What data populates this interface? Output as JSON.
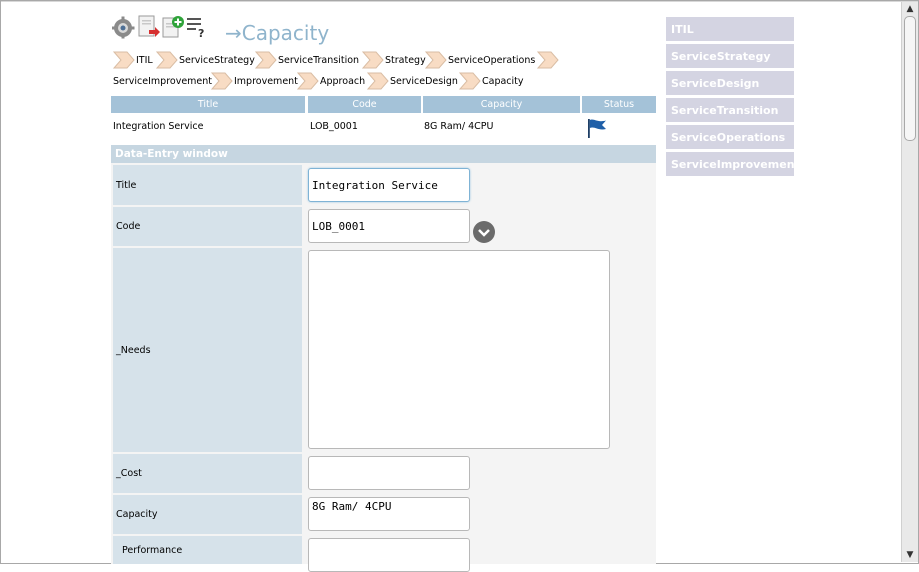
{
  "page": {
    "title": "→Capacity"
  },
  "toolbar": {
    "icons": [
      "settings-gear-icon",
      "export-document-icon",
      "add-document-icon",
      "help-list-icon"
    ]
  },
  "breadcrumbs": [
    "ITIL",
    "ServiceStrategy",
    "ServiceTransition",
    "Strategy",
    "ServiceOperations",
    "ServiceImprovement",
    "Improvement",
    "Approach",
    "ServiceDesign",
    "Capacity"
  ],
  "summary_table": {
    "headers": [
      "Title",
      "Code",
      "Capacity",
      "Status"
    ],
    "row": {
      "title": "Integration Service",
      "code": "LOB_0001",
      "capacity": "8G Ram/ 4CPU",
      "status_icon": "blue-flag-icon"
    }
  },
  "entry": {
    "header": "Data-Entry window",
    "fields": {
      "title": {
        "label": "Title",
        "value": "Integration Service"
      },
      "code": {
        "label": "Code",
        "value": "LOB_0001"
      },
      "needs": {
        "label": "_Needs",
        "value": ""
      },
      "cost": {
        "label": "_Cost",
        "value": ""
      },
      "capacity": {
        "label": "Capacity",
        "value": "8G Ram/ 4CPU"
      },
      "performance": {
        "label": "Performance",
        "value": ""
      }
    }
  },
  "nav": [
    "ITIL",
    "ServiceStrategy",
    "ServiceDesign",
    "ServiceTransition",
    "ServiceOperations",
    "ServiceImprovement"
  ],
  "colors": {
    "accent": "#a4c2d8",
    "nav_bg": "#d4d4e2",
    "label_bg": "#d6e2ea",
    "title_color": "#8fb4cc"
  }
}
